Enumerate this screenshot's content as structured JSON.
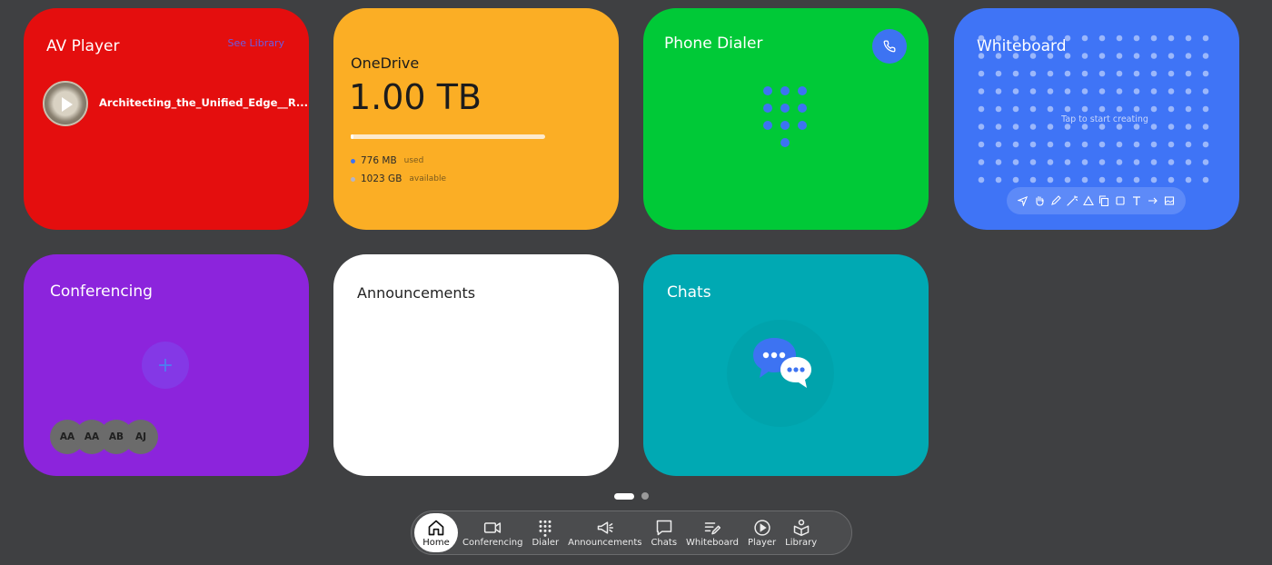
{
  "av_player": {
    "title": "AV Player",
    "see_library": "See Library",
    "track": "Architecting_the_Unified_Edge__R..."
  },
  "onedrive": {
    "title": "OneDrive",
    "total": "1.00 TB",
    "used_fraction": 0.0007,
    "used_value": "776 MB",
    "used_label": "used",
    "available_value": "1023 GB",
    "available_label": "available",
    "used_color": "#3d73f2",
    "available_color": "#b4b4c8"
  },
  "phone_dialer": {
    "title": "Phone Dialer"
  },
  "whiteboard": {
    "title": "Whiteboard",
    "hint": "Tap to start creating",
    "tools": [
      "select-icon",
      "hand-icon",
      "pen-icon",
      "magic-wand-icon",
      "triangle-icon",
      "copy-icon",
      "square-icon",
      "text-icon",
      "arrow-icon",
      "image-icon"
    ]
  },
  "conferencing": {
    "title": "Conferencing",
    "participants": [
      "AA",
      "AA",
      "AB",
      "AJ"
    ]
  },
  "announcements": {
    "title": "Announcements"
  },
  "chats": {
    "title": "Chats"
  },
  "pager": {
    "current": 1,
    "total": 2
  },
  "dock": {
    "items": [
      {
        "label": "Home",
        "icon": "home-icon",
        "active": true
      },
      {
        "label": "Conferencing",
        "icon": "video-camera-icon"
      },
      {
        "label": "Dialer",
        "icon": "dialpad-icon"
      },
      {
        "label": "Announcements",
        "icon": "megaphone-icon"
      },
      {
        "label": "Chats",
        "icon": "chat-bubble-icon"
      },
      {
        "label": "Whiteboard",
        "icon": "whiteboard-icon"
      },
      {
        "label": "Player",
        "icon": "play-circle-icon"
      },
      {
        "label": "Library",
        "icon": "library-icon"
      }
    ]
  },
  "colors": {
    "av_player": "#e40e0e",
    "onedrive": "#fbae25",
    "phone_dialer": "#00c937",
    "whiteboard": "#3f74f6",
    "conferencing": "#8c24dc",
    "announcements": "#ffffff",
    "chats": "#00a9b3",
    "accent": "#3d73f2"
  }
}
